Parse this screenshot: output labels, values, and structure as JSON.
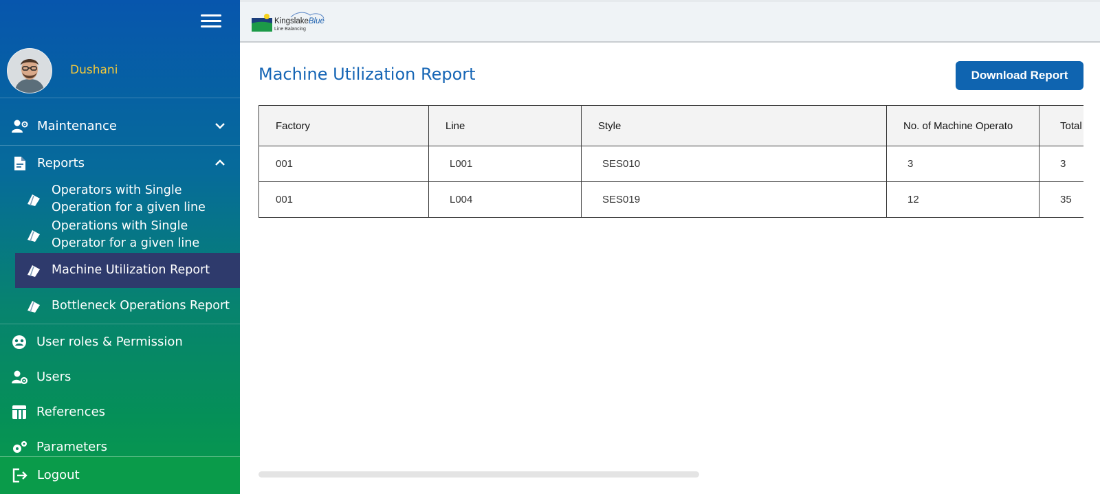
{
  "app": {
    "logo_brand": "Kingslake",
    "logo_brand_accent": "Blue",
    "logo_tagline": "Line Balancing"
  },
  "user": {
    "name": "Dushani"
  },
  "sidebar": {
    "items": [
      {
        "label": "Maintenance",
        "icon": "user-gear-icon",
        "expanded": false
      },
      {
        "label": "Reports",
        "icon": "document-icon",
        "expanded": true,
        "children": [
          {
            "label_line1": "Operators with Single",
            "label_line2": "Operation for a given line"
          },
          {
            "label_line1": "Operations with Single",
            "label_line2": "Operator for a given line"
          },
          {
            "label": "Machine Utilization Report",
            "active": true
          },
          {
            "label": "Bottleneck Operations Report"
          }
        ]
      },
      {
        "label": "User roles & Permission",
        "icon": "roles-icon"
      },
      {
        "label": "Users",
        "icon": "user-settings-icon"
      },
      {
        "label": "References",
        "icon": "table-icon"
      },
      {
        "label": "Parameters",
        "icon": "cogs-icon"
      }
    ],
    "logout_label": "Logout"
  },
  "main": {
    "title": "Machine Utilization Report",
    "download_label": "Download Report",
    "table": {
      "columns": [
        "Factory",
        "Line",
        "Style",
        "No. of Machine Operato",
        "Total"
      ],
      "rows": [
        [
          "001",
          "L001",
          "SES010",
          "3",
          "3"
        ],
        [
          "001",
          "L004",
          "SES019",
          "12",
          "35"
        ]
      ]
    }
  },
  "colors": {
    "sidebar_top": "#0756ad",
    "sidebar_bottom": "#0a9b4a",
    "active_item": "#2e3a6c",
    "username": "#f3c93b",
    "title": "#1565b5",
    "button": "#0f64b0"
  }
}
